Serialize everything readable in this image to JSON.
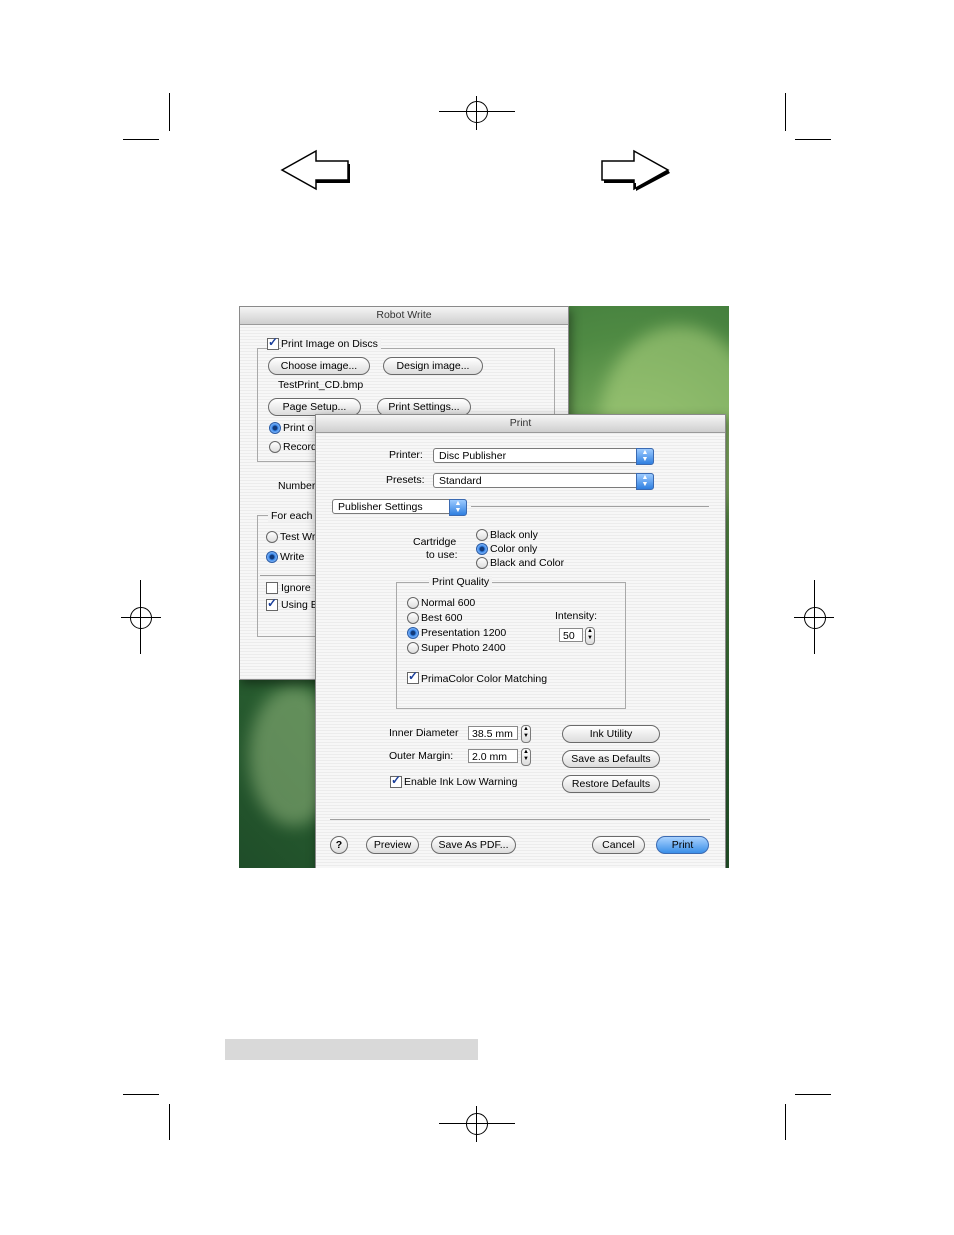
{
  "colors": {
    "accent_blue": "#3a8fe8",
    "desktop_green": "#2f6a34",
    "footer_bar": "#d9d9d9"
  },
  "nav": {
    "back_icon": "left-arrow-icon",
    "forward_icon": "right-arrow-icon"
  },
  "robot_window": {
    "title": "Robot Write",
    "print_image_label": "Print Image on Discs",
    "choose_image": "Choose image...",
    "design_image": "Design image...",
    "filename": "TestPrint_CD.bmp",
    "page_setup": "Page Setup...",
    "print_settings": "Print Settings...",
    "print_option": "Print o",
    "record_option": "Record",
    "number_label": "Number",
    "for_each_label": "For each",
    "test_write": "Test Wr",
    "write": "Write",
    "ignore": "Ignore",
    "using": "Using E"
  },
  "print_dialog": {
    "title": "Print",
    "printer_label": "Printer:",
    "printer_value": "Disc Publisher",
    "presets_label": "Presets:",
    "presets_value": "Standard",
    "panel_value": "Publisher Settings",
    "cartridge_label_1": "Cartridge",
    "cartridge_label_2": "to use:",
    "cartridge_options": [
      "Black only",
      "Color only",
      "Black and Color"
    ],
    "print_quality_legend": "Print Quality",
    "quality_options": [
      "Normal 600",
      "Best 600",
      "Presentation 1200",
      "Super Photo 2400"
    ],
    "intensity_label": "Intensity:",
    "intensity_value": "50",
    "primacolor_label": "PrimaColor Color Matching",
    "inner_diameter_label": "Inner Diameter",
    "inner_diameter_value": "38.5 mm",
    "outer_margin_label": "Outer Margin:",
    "outer_margin_value": "2.0 mm",
    "ink_low_label": "Enable Ink Low Warning",
    "ink_utility": "Ink Utility",
    "save_defaults": "Save as Defaults",
    "restore_defaults": "Restore Defaults",
    "help": "?",
    "preview": "Preview",
    "save_pdf": "Save As PDF...",
    "cancel": "Cancel",
    "print": "Print"
  }
}
